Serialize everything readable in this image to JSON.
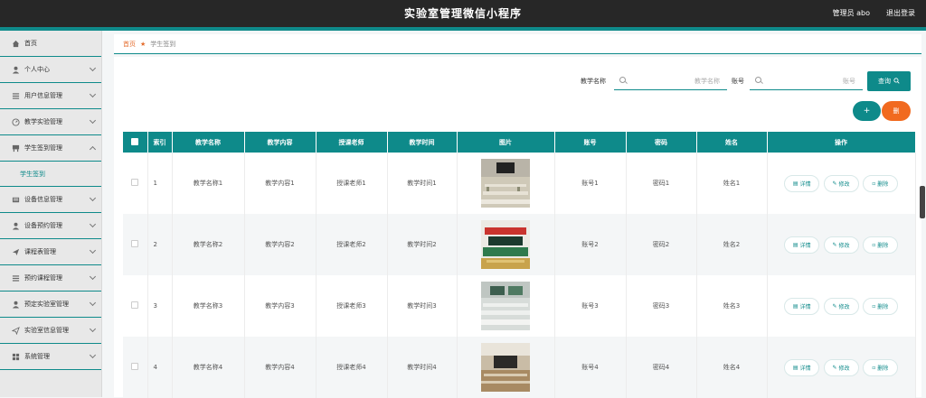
{
  "header": {
    "title": "实验室管理微信小程序",
    "admin": "管理员 abo",
    "logout": "退出登录"
  },
  "sidebar": {
    "items": [
      {
        "label": "首页",
        "icon": "home-icon"
      },
      {
        "label": "个人中心",
        "icon": "user-icon"
      },
      {
        "label": "用户信息管理",
        "icon": "list-icon"
      },
      {
        "label": "教学实验管理",
        "icon": "gauge-icon"
      },
      {
        "label": "学生签到管理",
        "icon": "desk-icon"
      },
      {
        "label": "设备信息管理",
        "icon": "device-icon"
      },
      {
        "label": "设备预约管理",
        "icon": "user-icon"
      },
      {
        "label": "课程表管理",
        "icon": "send-icon"
      },
      {
        "label": "预约课程管理",
        "icon": "list-icon"
      },
      {
        "label": "预定实验室管理",
        "icon": "user-icon"
      },
      {
        "label": "实验室信息管理",
        "icon": "send-icon"
      },
      {
        "label": "系统管理",
        "icon": "grid-icon"
      }
    ],
    "sub_item": "学生签到"
  },
  "breadcrumb": {
    "home": "首页",
    "current": "学生签到"
  },
  "search": {
    "label1": "教学名称",
    "placeholder1": "教学名称",
    "label2": "账号",
    "placeholder2": "账号",
    "query_label": "查询"
  },
  "toolbar": {
    "add_label": "+",
    "delete_label": "删"
  },
  "table": {
    "headers": [
      "索引",
      "教学名称",
      "教学内容",
      "授课老师",
      "教学时间",
      "图片",
      "账号",
      "密码",
      "姓名",
      "操作"
    ],
    "actions": {
      "detail": "详情",
      "edit": "修改",
      "delete": "删除"
    },
    "rows": [
      {
        "index": "1",
        "name": "教学名称1",
        "content": "教学内容1",
        "teacher": "授课老师1",
        "time": "教学时间1",
        "account": "账号1",
        "password": "密码1",
        "person": "姓名1"
      },
      {
        "index": "2",
        "name": "教学名称2",
        "content": "教学内容2",
        "teacher": "授课老师2",
        "time": "教学时间2",
        "account": "账号2",
        "password": "密码2",
        "person": "姓名2"
      },
      {
        "index": "3",
        "name": "教学名称3",
        "content": "教学内容3",
        "teacher": "授课老师3",
        "time": "教学时间3",
        "account": "账号3",
        "password": "密码3",
        "person": "姓名3"
      },
      {
        "index": "4",
        "name": "教学名称4",
        "content": "教学内容4",
        "teacher": "授课老师4",
        "time": "教学时间4",
        "account": "账号4",
        "password": "密码4",
        "person": "姓名4"
      }
    ]
  },
  "colors": {
    "accent": "#0e8a8a",
    "orange": "#f16a1f",
    "topbar": "#272727"
  }
}
